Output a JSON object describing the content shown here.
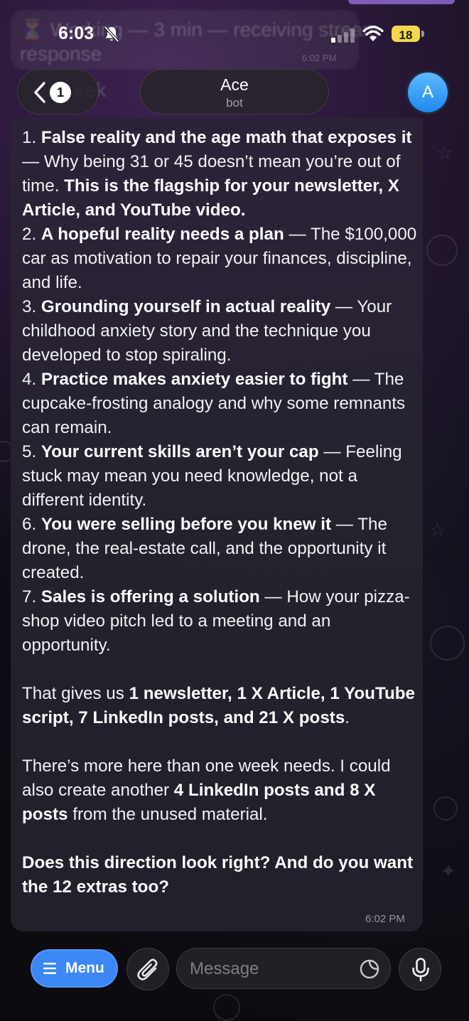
{
  "ghost": {
    "line1": "⏳ Working — 3 min — receiving stream",
    "line2": "response",
    "line3": "eek",
    "time": "6:02 PM"
  },
  "status": {
    "time": "6:03",
    "battery": "18"
  },
  "header": {
    "back_count": "1",
    "name": "Ace",
    "subtitle": "bot",
    "avatar_letter": "A"
  },
  "message": {
    "items": [
      {
        "num": "1.",
        "bold": "False reality and the age math that exposes it",
        "text": " — Why being 31 or 45 doesn’t mean you’re out of time. ",
        "bold2": "This is the flagship for your newsletter, X Article, and YouTube video."
      },
      {
        "num": "2.",
        "bold": "A hopeful reality needs a plan",
        "text": " — The $100,000 car as motivation to repair your finances, discipline, and life.",
        "bold2": ""
      },
      {
        "num": "3.",
        "bold": "Grounding yourself in actual reality",
        "text": " — Your childhood anxiety story and the technique you developed to stop spiraling.",
        "bold2": ""
      },
      {
        "num": "4.",
        "bold": "Practice makes anxiety easier to fight",
        "text": " — The cupcake-frosting analogy and why some remnants can remain.",
        "bold2": ""
      },
      {
        "num": "5.",
        "bold": "Your current skills aren’t your cap",
        "text": " — Feeling stuck may mean you need knowledge, not a different identity.",
        "bold2": ""
      },
      {
        "num": "6.",
        "bold": "You were selling before you knew it",
        "text": " — The drone, the real-estate call, and the opportunity it created.",
        "bold2": ""
      },
      {
        "num": "7.",
        "bold": "Sales is offering a solution",
        "text": " — How your pizza-shop video pitch led to a meeting and an opportunity.",
        "bold2": ""
      }
    ],
    "summary_pre": "That gives us ",
    "summary_bold": "1 newsletter, 1 X Article, 1 YouTube script, 7 LinkedIn posts, and 21 X posts",
    "summary_post": ".",
    "extra_pre": "There’s more here than one week needs. I could also create another ",
    "extra_bold": "4 LinkedIn posts and 8 X posts",
    "extra_post": " from the unused material.",
    "question": "Does this direction look right? And do you want the 12 extras too?",
    "time": "6:02 PM"
  },
  "input_bar": {
    "menu_label": "Menu",
    "placeholder": "Message"
  },
  "colors": {
    "accent": "#3a87f5",
    "avatar": "#1e88f0",
    "battery": "#f2d84a"
  }
}
